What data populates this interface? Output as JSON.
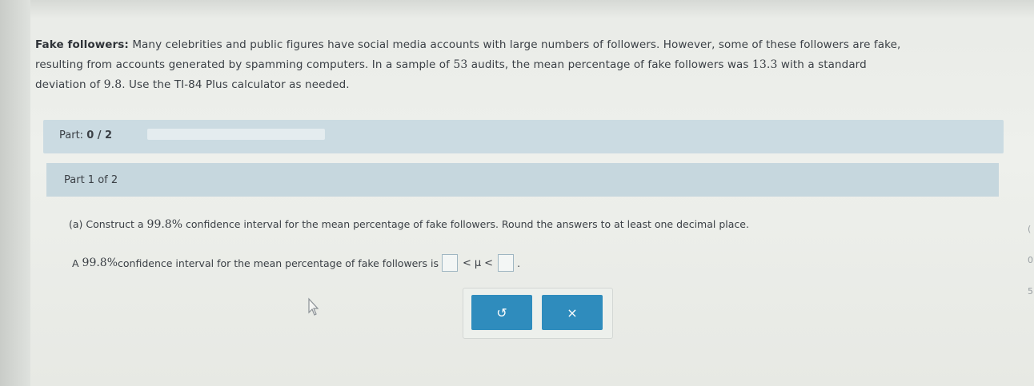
{
  "intro": {
    "title": "Fake followers:",
    "text1": " Many celebrities and public figures have social media accounts with large numbers of followers. However, some of these followers are fake,",
    "text2": "resulting from accounts generated by spamming computers. In a sample of ",
    "n": "53",
    "text3": " audits, the mean percentage of fake followers was ",
    "mean": "13.3",
    "text4": " with a standard",
    "text5": "deviation of ",
    "sd": "9.8",
    "text6": ". Use the TI-84 Plus calculator as needed."
  },
  "progress": {
    "label": "Part: ",
    "value": "0 / 2",
    "completed_fraction": 0
  },
  "part_header": "Part 1 of 2",
  "question": {
    "prefix": "(a) Construct a ",
    "level": "99.8%",
    "suffix": " confidence interval for the mean percentage of fake followers. Round the answers to at least one decimal place.",
    "answer_prefix": "A ",
    "answer_level": "99.8%",
    "answer_suffix": " confidence interval for the mean percentage of fake followers is ",
    "lower_value": "",
    "upper_value": "",
    "ineq_left": "<",
    "mu": "μ",
    "ineq_right": "<",
    "period": "."
  },
  "buttons": {
    "undo_glyph": "↺",
    "clear_glyph": "×"
  },
  "right_edge": [
    "(",
    "0",
    "5"
  ],
  "colors": {
    "button": "#2f8cbd",
    "part_bar": "#cbdbe2"
  }
}
